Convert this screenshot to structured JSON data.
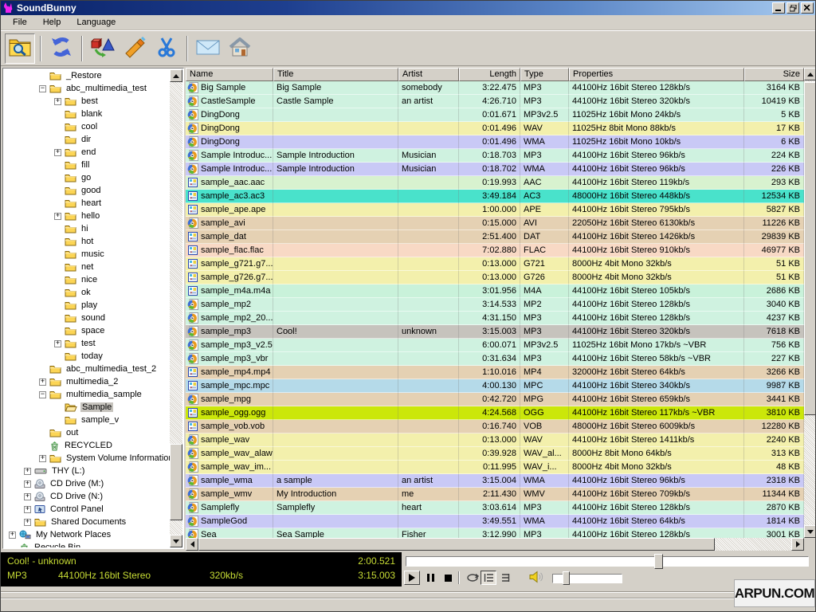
{
  "window": {
    "title": "SoundBunny"
  },
  "menus": [
    "File",
    "Help",
    "Language"
  ],
  "toolbar": {
    "buttons": [
      {
        "name": "browse-folder",
        "icon": "folder-search",
        "pressed": true
      },
      {
        "sep": true
      },
      {
        "name": "refresh",
        "icon": "refresh",
        "pressed": false
      },
      {
        "sep": true
      },
      {
        "name": "convert",
        "icon": "convert",
        "pressed": false
      },
      {
        "name": "glue",
        "icon": "glue",
        "pressed": false
      },
      {
        "name": "cut",
        "icon": "scissors",
        "pressed": false
      },
      {
        "sep": true
      },
      {
        "name": "mail",
        "icon": "mail",
        "pressed": false
      },
      {
        "name": "home",
        "icon": "home",
        "pressed": false
      }
    ]
  },
  "tree": {
    "items": [
      {
        "label": "_Restore",
        "level": 2,
        "expand": null,
        "icon": "folder"
      },
      {
        "label": "abc_multimedia_test",
        "level": 2,
        "expand": "-",
        "icon": "folder"
      },
      {
        "label": "best",
        "level": 3,
        "expand": "+",
        "icon": "folder"
      },
      {
        "label": "blank",
        "level": 3,
        "expand": null,
        "icon": "folder"
      },
      {
        "label": "cool",
        "level": 3,
        "expand": null,
        "icon": "folder"
      },
      {
        "label": "dir",
        "level": 3,
        "expand": null,
        "icon": "folder"
      },
      {
        "label": "end",
        "level": 3,
        "expand": "+",
        "icon": "folder"
      },
      {
        "label": "fill",
        "level": 3,
        "expand": null,
        "icon": "folder"
      },
      {
        "label": "go",
        "level": 3,
        "expand": null,
        "icon": "folder"
      },
      {
        "label": "good",
        "level": 3,
        "expand": null,
        "icon": "folder"
      },
      {
        "label": "heart",
        "level": 3,
        "expand": null,
        "icon": "folder"
      },
      {
        "label": "hello",
        "level": 3,
        "expand": "+",
        "icon": "folder"
      },
      {
        "label": "hi",
        "level": 3,
        "expand": null,
        "icon": "folder"
      },
      {
        "label": "hot",
        "level": 3,
        "expand": null,
        "icon": "folder"
      },
      {
        "label": "music",
        "level": 3,
        "expand": null,
        "icon": "folder"
      },
      {
        "label": "net",
        "level": 3,
        "expand": null,
        "icon": "folder"
      },
      {
        "label": "nice",
        "level": 3,
        "expand": null,
        "icon": "folder"
      },
      {
        "label": "ok",
        "level": 3,
        "expand": null,
        "icon": "folder"
      },
      {
        "label": "play",
        "level": 3,
        "expand": null,
        "icon": "folder"
      },
      {
        "label": "sound",
        "level": 3,
        "expand": null,
        "icon": "folder"
      },
      {
        "label": "space",
        "level": 3,
        "expand": null,
        "icon": "folder"
      },
      {
        "label": "test",
        "level": 3,
        "expand": "+",
        "icon": "folder"
      },
      {
        "label": "today",
        "level": 3,
        "expand": null,
        "icon": "folder"
      },
      {
        "label": "abc_multimedia_test_2",
        "level": 2,
        "expand": null,
        "icon": "folder"
      },
      {
        "label": "multimedia_2",
        "level": 2,
        "expand": "+",
        "icon": "folder"
      },
      {
        "label": "multimedia_sample",
        "level": 2,
        "expand": "-",
        "icon": "folder"
      },
      {
        "label": "Sample",
        "level": 3,
        "expand": null,
        "icon": "folder-open",
        "selected": true
      },
      {
        "label": "sample_v",
        "level": 3,
        "expand": null,
        "icon": "folder"
      },
      {
        "label": "out",
        "level": 2,
        "expand": null,
        "icon": "folder"
      },
      {
        "label": "RECYCLED",
        "level": 2,
        "expand": null,
        "icon": "recycle"
      },
      {
        "label": "System Volume Information",
        "level": 2,
        "expand": "+",
        "icon": "folder"
      },
      {
        "label": "THY (L:)",
        "level": 1,
        "expand": "+",
        "icon": "drive"
      },
      {
        "label": "CD Drive (M:)",
        "level": 1,
        "expand": "+",
        "icon": "cd"
      },
      {
        "label": "CD Drive (N:)",
        "level": 1,
        "expand": "+",
        "icon": "cd"
      },
      {
        "label": "Control Panel",
        "level": 1,
        "expand": "+",
        "icon": "control"
      },
      {
        "label": "Shared Documents",
        "level": 1,
        "expand": "+",
        "icon": "folder"
      },
      {
        "label": "My Network Places",
        "level": 0,
        "expand": "+",
        "icon": "network"
      },
      {
        "label": "Recycle Bin",
        "level": 0,
        "expand": null,
        "icon": "recycle"
      }
    ]
  },
  "colors": {
    "cyan": "#cff2e0",
    "yellow": "#f3f0ac",
    "lavender": "#c9c9f6",
    "green": "#d8f2cf",
    "turquoise": "#49e2cb",
    "tan": "#e5d1b3",
    "salmon": "#f8d9c5",
    "mint": "#c9f2da",
    "blue": "#b5dae9",
    "chartreuse": "#cbe70a",
    "selected": "#c6c3bd"
  },
  "table": {
    "columns": [
      {
        "label": "Name",
        "align": "left"
      },
      {
        "label": "Title",
        "align": "left"
      },
      {
        "label": "Artist",
        "align": "left"
      },
      {
        "label": "Length",
        "align": "right"
      },
      {
        "label": "Type",
        "align": "left"
      },
      {
        "label": "Properties",
        "align": "left"
      },
      {
        "label": "Size",
        "align": "right"
      }
    ],
    "rows": [
      {
        "name": "Big Sample",
        "title": "Big Sample",
        "artist": "somebody",
        "length": "3:22.475",
        "type": "MP3",
        "props": "44100Hz 16bit Stereo 128kb/s",
        "size": "3164 KB",
        "color": "cyan",
        "icon": "player"
      },
      {
        "name": "CastleSample",
        "title": "Castle Sample",
        "artist": "an artist",
        "length": "4:26.710",
        "type": "MP3",
        "props": "44100Hz 16bit Stereo 320kb/s",
        "size": "10419 KB",
        "color": "cyan",
        "icon": "player"
      },
      {
        "name": "DingDong",
        "title": "",
        "artist": "",
        "length": "0:01.671",
        "type": "MP3v2.5",
        "props": "11025Hz 16bit Mono 24kb/s",
        "size": "5 KB",
        "color": "cyan",
        "icon": "player"
      },
      {
        "name": "DingDong",
        "title": "",
        "artist": "",
        "length": "0:01.496",
        "type": "WAV",
        "props": "11025Hz 8bit Mono 88kb/s",
        "size": "17 KB",
        "color": "yellow",
        "icon": "player"
      },
      {
        "name": "DingDong",
        "title": "",
        "artist": "",
        "length": "0:01.496",
        "type": "WMA",
        "props": "11025Hz 16bit Mono 10kb/s",
        "size": "6 KB",
        "color": "lavender",
        "icon": "player"
      },
      {
        "name": "Sample Introduc...",
        "title": "Sample Introduction",
        "artist": "Musician",
        "length": "0:18.703",
        "type": "MP3",
        "props": "44100Hz 16bit Stereo 96kb/s",
        "size": "224 KB",
        "color": "cyan",
        "icon": "player"
      },
      {
        "name": "Sample Introduc...",
        "title": "Sample Introduction",
        "artist": "Musician",
        "length": "0:18.702",
        "type": "WMA",
        "props": "44100Hz 16bit Stereo 96kb/s",
        "size": "226 KB",
        "color": "lavender",
        "icon": "player"
      },
      {
        "name": "sample_aac.aac",
        "title": "",
        "artist": "",
        "length": "0:19.993",
        "type": "AAC",
        "props": "44100Hz 16bit Stereo 119kb/s",
        "size": "293 KB",
        "color": "green",
        "icon": "doc"
      },
      {
        "name": "sample_ac3.ac3",
        "title": "",
        "artist": "",
        "length": "3:49.184",
        "type": "AC3",
        "props": "48000Hz 16bit Stereo 448kb/s",
        "size": "12534 KB",
        "color": "turquoise",
        "icon": "doc"
      },
      {
        "name": "sample_ape.ape",
        "title": "",
        "artist": "",
        "length": "1:00.000",
        "type": "APE",
        "props": "44100Hz 16bit Stereo 795kb/s",
        "size": "5827 KB",
        "color": "yellow",
        "icon": "doc"
      },
      {
        "name": "sample_avi",
        "title": "",
        "artist": "",
        "length": "0:15.000",
        "type": "AVI",
        "props": "22050Hz 16bit Stereo 6130kb/s",
        "size": "11226 KB",
        "color": "tan",
        "icon": "player"
      },
      {
        "name": "sample_dat",
        "title": "",
        "artist": "",
        "length": "2:51.400",
        "type": "DAT",
        "props": "44100Hz 16bit Stereo 1426kb/s",
        "size": "29839 KB",
        "color": "tan",
        "icon": "doc"
      },
      {
        "name": "sample_flac.flac",
        "title": "",
        "artist": "",
        "length": "7:02.880",
        "type": "FLAC",
        "props": "44100Hz 16bit Stereo 910kb/s",
        "size": "46977 KB",
        "color": "salmon",
        "icon": "doc"
      },
      {
        "name": "sample_g721.g7...",
        "title": "",
        "artist": "",
        "length": "0:13.000",
        "type": "G721",
        "props": "8000Hz 4bit Mono 32kb/s",
        "size": "51 KB",
        "color": "yellow",
        "icon": "doc"
      },
      {
        "name": "sample_g726.g7...",
        "title": "",
        "artist": "",
        "length": "0:13.000",
        "type": "G726",
        "props": "8000Hz 4bit Mono 32kb/s",
        "size": "51 KB",
        "color": "yellow",
        "icon": "doc"
      },
      {
        "name": "sample_m4a.m4a",
        "title": "",
        "artist": "",
        "length": "3:01.956",
        "type": "M4A",
        "props": "44100Hz 16bit Stereo 105kb/s",
        "size": "2686 KB",
        "color": "mint",
        "icon": "doc"
      },
      {
        "name": "sample_mp2",
        "title": "",
        "artist": "",
        "length": "3:14.533",
        "type": "MP2",
        "props": "44100Hz 16bit Stereo 128kb/s",
        "size": "3040 KB",
        "color": "cyan",
        "icon": "player"
      },
      {
        "name": "sample_mp2_20...",
        "title": "",
        "artist": "",
        "length": "4:31.150",
        "type": "MP3",
        "props": "44100Hz 16bit Stereo 128kb/s",
        "size": "4237 KB",
        "color": "cyan",
        "icon": "player"
      },
      {
        "name": "sample_mp3",
        "title": "Cool!",
        "artist": "unknown",
        "length": "3:15.003",
        "type": "MP3",
        "props": "44100Hz 16bit Stereo 320kb/s",
        "size": "7618 KB",
        "color": "selected",
        "icon": "player",
        "selected": true
      },
      {
        "name": "sample_mp3_v2.5",
        "title": "",
        "artist": "",
        "length": "6:00.071",
        "type": "MP3v2.5",
        "props": "11025Hz 16bit Mono 17kb/s ~VBR",
        "size": "756 KB",
        "color": "cyan",
        "icon": "player"
      },
      {
        "name": "sample_mp3_vbr",
        "title": "",
        "artist": "",
        "length": "0:31.634",
        "type": "MP3",
        "props": "44100Hz 16bit Stereo 58kb/s ~VBR",
        "size": "227 KB",
        "color": "cyan",
        "icon": "player"
      },
      {
        "name": "sample_mp4.mp4",
        "title": "",
        "artist": "",
        "length": "1:10.016",
        "type": "MP4",
        "props": "32000Hz 16bit Stereo 64kb/s",
        "size": "3266 KB",
        "color": "tan",
        "icon": "doc"
      },
      {
        "name": "sample_mpc.mpc",
        "title": "",
        "artist": "",
        "length": "4:00.130",
        "type": "MPC",
        "props": "44100Hz 16bit Stereo 340kb/s",
        "size": "9987 KB",
        "color": "blue",
        "icon": "doc"
      },
      {
        "name": "sample_mpg",
        "title": "",
        "artist": "",
        "length": "0:42.720",
        "type": "MPG",
        "props": "44100Hz 16bit Stereo 659kb/s",
        "size": "3441 KB",
        "color": "tan",
        "icon": "player"
      },
      {
        "name": "sample_ogg.ogg",
        "title": "",
        "artist": "",
        "length": "4:24.568",
        "type": "OGG",
        "props": "44100Hz 16bit Stereo 117kb/s ~VBR",
        "size": "3810 KB",
        "color": "chartreuse",
        "icon": "doc"
      },
      {
        "name": "sample_vob.vob",
        "title": "",
        "artist": "",
        "length": "0:16.740",
        "type": "VOB",
        "props": "48000Hz 16bit Stereo 6009kb/s",
        "size": "12280 KB",
        "color": "tan",
        "icon": "doc"
      },
      {
        "name": "sample_wav",
        "title": "",
        "artist": "",
        "length": "0:13.000",
        "type": "WAV",
        "props": "44100Hz 16bit Stereo 1411kb/s",
        "size": "2240 KB",
        "color": "yellow",
        "icon": "player"
      },
      {
        "name": "sample_wav_alaw",
        "title": "",
        "artist": "",
        "length": "0:39.928",
        "type": "WAV_al...",
        "props": "8000Hz 8bit Mono 64kb/s",
        "size": "313 KB",
        "color": "yellow",
        "icon": "player"
      },
      {
        "name": "sample_wav_im...",
        "title": "",
        "artist": "",
        "length": "0:11.995",
        "type": "WAV_i...",
        "props": "8000Hz 4bit Mono 32kb/s",
        "size": "48 KB",
        "color": "yellow",
        "icon": "player"
      },
      {
        "name": "sample_wma",
        "title": "a sample",
        "artist": "an artist",
        "length": "3:15.004",
        "type": "WMA",
        "props": "44100Hz 16bit Stereo 96kb/s",
        "size": "2318 KB",
        "color": "lavender",
        "icon": "player"
      },
      {
        "name": "sample_wmv",
        "title": "My Introduction",
        "artist": "me",
        "length": "2:11.430",
        "type": "WMV",
        "props": "44100Hz 16bit Stereo 709kb/s",
        "size": "11344 KB",
        "color": "tan",
        "icon": "player"
      },
      {
        "name": "Samplefly",
        "title": "Samplefly",
        "artist": "heart",
        "length": "3:03.614",
        "type": "MP3",
        "props": "44100Hz 16bit Stereo 128kb/s",
        "size": "2870 KB",
        "color": "cyan",
        "icon": "player"
      },
      {
        "name": "SampleGod",
        "title": "",
        "artist": "",
        "length": "3:49.551",
        "type": "WMA",
        "props": "44100Hz 16bit Stereo 64kb/s",
        "size": "1814 KB",
        "color": "lavender",
        "icon": "player"
      },
      {
        "name": "Sea",
        "title": "Sea Sample",
        "artist": "Fisher",
        "length": "3:12.990",
        "type": "MP3",
        "props": "44100Hz 16bit Stereo 128kb/s",
        "size": "3001 KB",
        "color": "cyan",
        "icon": "player"
      }
    ]
  },
  "player": {
    "now_playing": "Cool! - unknown",
    "elapsed": "2:00.521",
    "format": "MP3",
    "sample_info": "44100Hz 16bit Stereo",
    "bitrate": "320kb/s",
    "total": "3:15.003",
    "seek_percent": 62,
    "volume_percent": 17
  },
  "watermark": "ARPUN.COM"
}
